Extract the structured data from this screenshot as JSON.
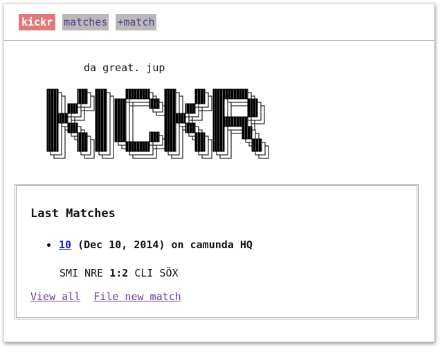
{
  "nav": {
    "brand": "kickr",
    "items": [
      "matches",
      "+match"
    ]
  },
  "tagline": "da great. jup",
  "logo_text": "KICKR",
  "panel": {
    "title": "Last Matches",
    "matches": [
      {
        "number": "10",
        "details": "(Dec 10, 2014) on camunda HQ",
        "team_a": "SMI NRE",
        "score": "1:2",
        "team_b": "CLI SÖX"
      }
    ],
    "links": {
      "view_all": "View all",
      "file_new": "File new match"
    }
  },
  "colors": {
    "brand_bg": "#e07a7a",
    "nav_item_bg": "#b9b9b9",
    "link": "#6a3d9a",
    "match_link": "#1a1acc"
  }
}
